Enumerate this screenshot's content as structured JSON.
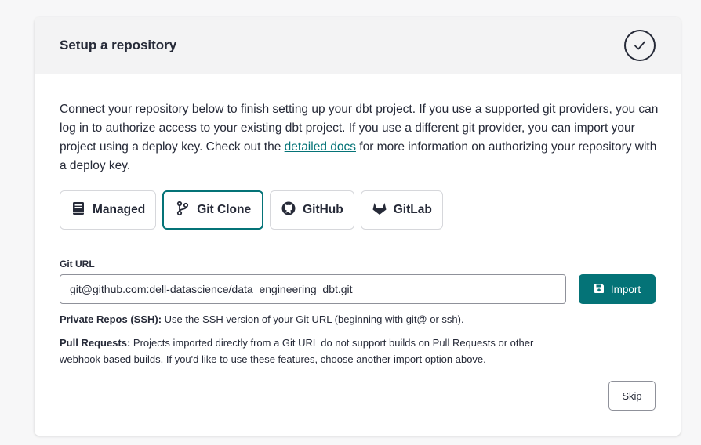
{
  "header": {
    "title": "Setup a repository",
    "status_icon": "check-circle-icon"
  },
  "intro": {
    "text_before_link": "Connect your repository below to finish setting up your dbt project. If you use a supported git providers, you can log in to authorize access to your existing dbt project. If you use a different git provider, you can import your project using a deploy key. Check out the ",
    "link_text": "detailed docs",
    "text_after_link": " for more information on authorizing your repository with a deploy key."
  },
  "providers": [
    {
      "label": "Managed",
      "icon": "book-icon",
      "active": false
    },
    {
      "label": "Git Clone",
      "icon": "git-branch-icon",
      "active": true
    },
    {
      "label": "GitHub",
      "icon": "github-icon",
      "active": false
    },
    {
      "label": "GitLab",
      "icon": "gitlab-icon",
      "active": false
    }
  ],
  "git_url": {
    "label": "Git URL",
    "value": "git@github.com:dell-datascience/data_engineering_dbt.git"
  },
  "import_button": {
    "label": "Import",
    "icon": "save-icon"
  },
  "notes": {
    "private_title": "Private Repos (SSH):",
    "private_text": " Use the SSH version of your Git URL (beginning with git@ or ssh).",
    "pull_title": "Pull Requests:",
    "pull_text": " Projects imported directly from a Git URL do not support builds on Pull Requests or other webhook based builds. If you'd like to use these features, choose another import option above."
  },
  "skip_button": {
    "label": "Skip"
  },
  "colors": {
    "accent": "#047377",
    "text": "#262a38",
    "header_bg": "#f3f3f4"
  }
}
